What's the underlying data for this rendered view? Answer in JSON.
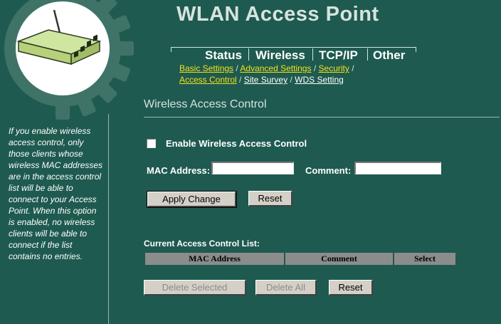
{
  "header": {
    "title": "WLAN Access Point"
  },
  "nav": {
    "tabs": [
      {
        "label": "Status"
      },
      {
        "label": "Wireless"
      },
      {
        "label": "TCP/IP"
      },
      {
        "label": "Other"
      }
    ],
    "sub_links": [
      {
        "label": "Basic Settings",
        "color": "#f3e11a"
      },
      {
        "label": "Advanced Settings",
        "color": "#f3e11a"
      },
      {
        "label": "Security",
        "color": "#f3e11a"
      },
      {
        "label": "Access Control",
        "color": "#f3e11a"
      },
      {
        "label": "Site Survey",
        "color": "#ffffff"
      },
      {
        "label": "WDS Setting",
        "color": "#ffffff"
      }
    ],
    "separator": "/"
  },
  "page": {
    "title": "Wireless Access Control"
  },
  "help_text": "If you enable wireless access control, only those clients whose wireless MAC addresses are in the access control list will be able to connect to your Access Point. When this option is enabled, no wireless clients will be able to connect if the list contains no entries.",
  "form": {
    "enable_label": "Enable Wireless Access Control",
    "enable_checked": false,
    "mac_label": "MAC Address:",
    "mac_value": "",
    "comment_label": "Comment:",
    "comment_value": "",
    "apply_label": "Apply Change",
    "reset_label": "Reset"
  },
  "list": {
    "title": "Current Access Control List:",
    "columns": [
      "MAC Address",
      "Comment",
      "Select"
    ],
    "rows": [],
    "delete_selected_label": "Delete Selected",
    "delete_all_label": "Delete All",
    "reset_label": "Reset"
  },
  "colors": {
    "background": "#1e5a4f",
    "link_active": "#f3e11a",
    "table_header": "#8c8c8c"
  },
  "icons": {
    "logo": "router-icon",
    "decoration": "gear-icon"
  }
}
